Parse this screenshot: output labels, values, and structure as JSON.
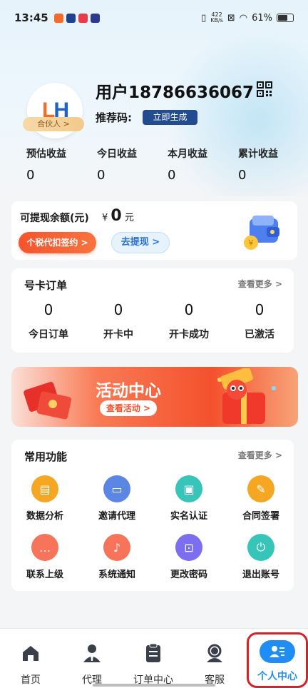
{
  "status_bar": {
    "time": "13:45",
    "net_speed_value": "422",
    "net_speed_unit": "KB/s",
    "battery": "61%"
  },
  "profile": {
    "username": "用户18786636067",
    "partner_badge": "合伙人 >",
    "referral_label": "推荐码:",
    "referral_button": "立即生成"
  },
  "stats": [
    {
      "label": "预估收益",
      "value": "0"
    },
    {
      "label": "今日收益",
      "value": "0"
    },
    {
      "label": "本月收益",
      "value": "0"
    },
    {
      "label": "累计收益",
      "value": "0"
    }
  ],
  "withdraw": {
    "title": "可提现余额(元)",
    "currency": "¥",
    "amount": "0",
    "unit": "元",
    "tax_button": "个税代扣签约 >",
    "withdraw_button": "去提现 >"
  },
  "orders": {
    "title": "号卡订单",
    "more": "查看更多 >",
    "items": [
      {
        "value": "0",
        "label": "今日订单"
      },
      {
        "value": "0",
        "label": "开卡中"
      },
      {
        "value": "0",
        "label": "开卡成功"
      },
      {
        "value": "0",
        "label": "已激活"
      }
    ]
  },
  "activity": {
    "title": "活动中心",
    "button": "查看活动 >"
  },
  "functions": {
    "title": "常用功能",
    "more": "查看更多 >",
    "items": [
      {
        "label": "数据分析",
        "icon": "chart-icon",
        "color": "#f5a623"
      },
      {
        "label": "邀请代理",
        "icon": "briefcase-icon",
        "color": "#5b86e5"
      },
      {
        "label": "实名认证",
        "icon": "id-card-icon",
        "color": "#36c5b8"
      },
      {
        "label": "合同签署",
        "icon": "contract-icon",
        "color": "#f5a623"
      },
      {
        "label": "联系上级",
        "icon": "chat-icon",
        "color": "#f7745a"
      },
      {
        "label": "系统通知",
        "icon": "bell-icon",
        "color": "#f7745a"
      },
      {
        "label": "更改密码",
        "icon": "lock-icon",
        "color": "#7b6ef0"
      },
      {
        "label": "退出账号",
        "icon": "power-icon",
        "color": "#36c5b8"
      }
    ]
  },
  "tabbar": {
    "items": [
      {
        "label": "首页",
        "icon": "home-icon"
      },
      {
        "label": "代理",
        "icon": "agent-icon"
      },
      {
        "label": "订单中心",
        "icon": "order-icon"
      },
      {
        "label": "客服",
        "icon": "support-icon"
      },
      {
        "label": "个人中心",
        "icon": "profile-icon",
        "active": true
      }
    ],
    "active_color": "#1e8ef4",
    "highlight_color": "#d72128"
  }
}
